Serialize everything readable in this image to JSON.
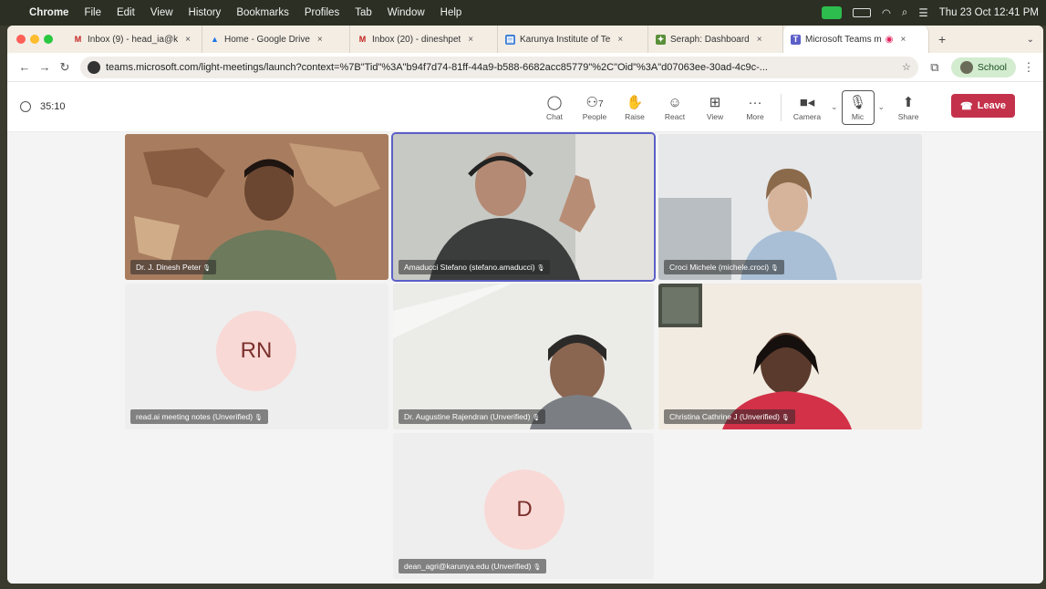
{
  "menubar": {
    "items": [
      "Chrome",
      "File",
      "Edit",
      "View",
      "History",
      "Bookmarks",
      "Profiles",
      "Tab",
      "Window",
      "Help"
    ],
    "clock": "Thu 23 Oct  12:41 PM"
  },
  "tabs": [
    {
      "label": "Inbox (9) - head_ia@k",
      "icon": "gmail-icon",
      "color": "#c5221f"
    },
    {
      "label": "Home - Google Drive",
      "icon": "drive-icon",
      "color": "#1a73e8"
    },
    {
      "label": "Inbox (20) - dineshpet",
      "icon": "gmail-icon",
      "color": "#c5221f"
    },
    {
      "label": "Karunya Institute of Te",
      "icon": "page-icon",
      "color": "#3f7fd6"
    },
    {
      "label": "Seraph: Dashboard",
      "icon": "seraph-icon",
      "color": "#5a8f3a"
    },
    {
      "label": "Microsoft Teams m",
      "icon": "teams-icon",
      "color": "#5b5fc7"
    }
  ],
  "address": {
    "url": "teams.microsoft.com/light-meetings/launch?context=%7B\"Tid\"%3A\"b94f7d74-81ff-44a9-b588-6682acc85779\"%2C\"Oid\"%3A\"d07063ee-30ad-4c9c-...",
    "profile": "School"
  },
  "meeting": {
    "elapsed": "35:10",
    "tools": [
      {
        "name": "chat",
        "label": "Chat",
        "glyph": "💬"
      },
      {
        "name": "people",
        "label": "People",
        "glyph": "👥",
        "count": "7"
      },
      {
        "name": "raise",
        "label": "Raise",
        "glyph": "✋"
      },
      {
        "name": "react",
        "label": "React",
        "glyph": "☺"
      },
      {
        "name": "view",
        "label": "View",
        "glyph": "⊞"
      },
      {
        "name": "more",
        "label": "More",
        "glyph": "···"
      }
    ],
    "camera_label": "Camera",
    "mic_label": "Mic",
    "share_label": "Share",
    "leave_label": "Leave"
  },
  "participants": [
    {
      "name": "Dr. J. Dinesh Peter",
      "video": true
    },
    {
      "name": "Amaducci Stefano (stefano.amaducci)",
      "video": true,
      "speaking": true
    },
    {
      "name": "Croci Michele (michele.croci)",
      "video": true
    },
    {
      "name": "read.ai meeting notes (Unverified)",
      "video": false,
      "initials": "RN"
    },
    {
      "name": "Dr. Augustine Rajendran (Unverified)",
      "video": true
    },
    {
      "name": "Christina Cathrine J (Unverified)",
      "video": true
    },
    {
      "name": "dean_agri@karunya.edu (Unverified)",
      "video": false,
      "initials": "D"
    }
  ]
}
